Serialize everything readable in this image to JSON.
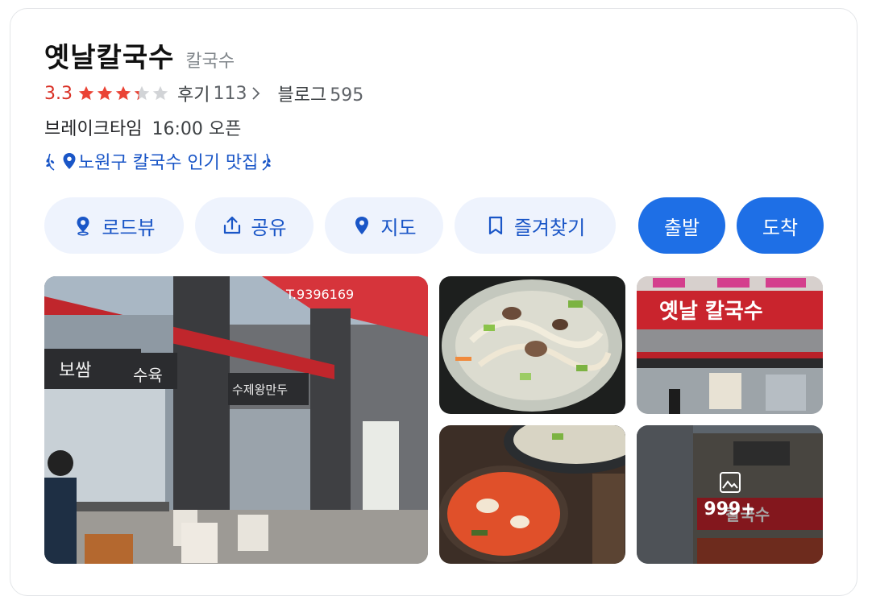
{
  "place": {
    "name": "옛날칼국수",
    "category": "칼국수",
    "rating": "3.3",
    "rating_value": 3.3,
    "review_label": "후기",
    "review_count": "113",
    "blog_label": "블로그",
    "blog_count": "595",
    "status_label": "브레이크타임",
    "status_value": "16:00 오픈",
    "award_text": "노원구 칼국수 인기 맛집"
  },
  "actions": [
    {
      "label": "로드뷰",
      "icon": "roadview-icon"
    },
    {
      "label": "공유",
      "icon": "share-icon"
    },
    {
      "label": "지도",
      "icon": "map-pin-icon"
    },
    {
      "label": "즐겨찾기",
      "icon": "bookmark-icon"
    }
  ],
  "route": {
    "depart": "출발",
    "arrive": "도착"
  },
  "photos": {
    "more_count": "999+",
    "storefront_signs": [
      "보쌈",
      "수육",
      "수제왕만두",
      "T.9396169",
      "옛날 칼국수",
      "칼국수"
    ]
  },
  "colors": {
    "accent": "#1e6fe6",
    "accent_light": "#eef3fd",
    "star": "#ea4335",
    "rating_text": "#d93025",
    "award_text": "#1a56c7"
  }
}
